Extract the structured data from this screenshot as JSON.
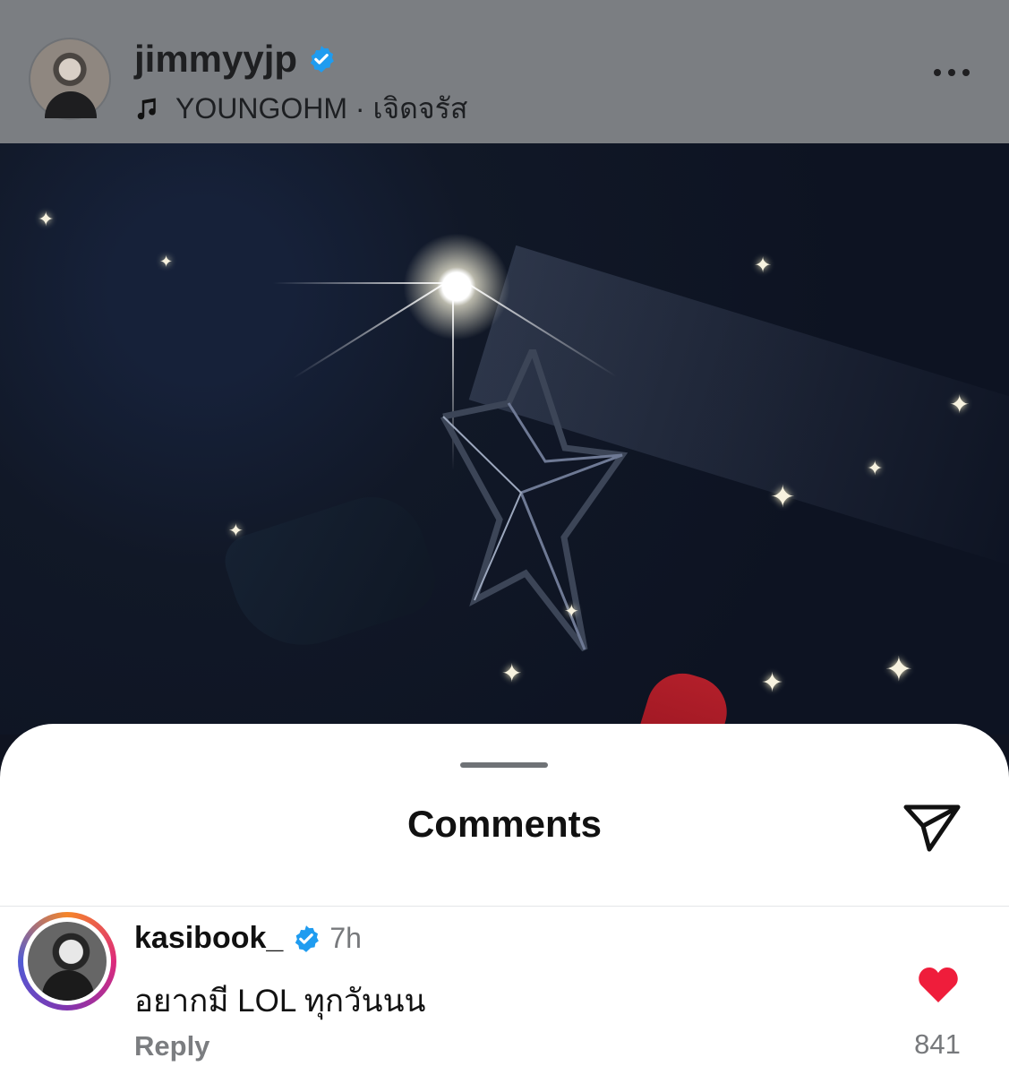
{
  "post": {
    "username": "jimmyyjp",
    "music": "YOUNGOHM · เจิดจรัส",
    "icons": {
      "verified": "verified-badge-icon",
      "music": "music-note-icon",
      "more": "more-options-icon"
    }
  },
  "comments_sheet": {
    "title": "Comments",
    "icons": {
      "share": "send-icon"
    }
  },
  "comment": {
    "username": "kasibook_",
    "time": "7h",
    "text": "อยากมี LOL ทุกวันนน",
    "reply_label": "Reply",
    "like_count": "841",
    "icons": {
      "verified": "verified-badge-icon",
      "like": "heart-icon"
    }
  },
  "colors": {
    "header_bg": "#7b7e82",
    "verified_blue": "#1f9cf0",
    "heart_red": "#ef1d3b"
  }
}
